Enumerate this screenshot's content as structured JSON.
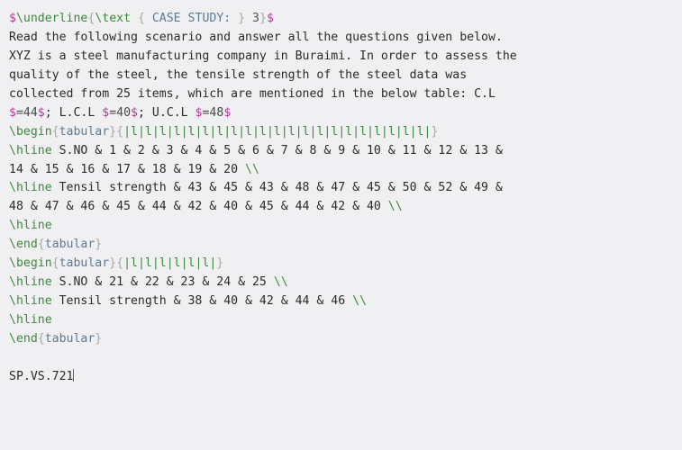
{
  "window": {
    "kind": "latex-source-editor",
    "background_color": "#f0f0f2",
    "font": "monospace",
    "colors": {
      "math_delimiter": "#b03a96",
      "command": "#3c8a3c",
      "brace": "#a8a8a8",
      "environment": "#5a7a96",
      "plain_text": "#2b2b2b",
      "cursor": "#3b6ea5"
    }
  },
  "document": {
    "lines": [
      {
        "id": "line-1",
        "tokens": [
          {
            "t": "$",
            "c": "math"
          },
          {
            "t": "\\underline",
            "c": "cmd"
          },
          {
            "t": "{",
            "c": "brace"
          },
          {
            "t": "\\text",
            "c": "cmd"
          },
          {
            "t": " ",
            "c": "plain"
          },
          {
            "t": "{",
            "c": "brace"
          },
          {
            "t": " CASE STUDY: ",
            "c": "env"
          },
          {
            "t": "}",
            "c": "brace"
          },
          {
            "t": " 3",
            "c": "arg"
          },
          {
            "t": "}",
            "c": "brace"
          },
          {
            "t": "$",
            "c": "math"
          }
        ]
      },
      {
        "id": "line-2",
        "tokens": [
          {
            "t": "Read the following scenario and answer all the questions given below.",
            "c": "plain"
          }
        ]
      },
      {
        "id": "line-3",
        "tokens": [
          {
            "t": "XYZ is a steel manufacturing company in Buraimi. In order to assess the",
            "c": "plain"
          }
        ]
      },
      {
        "id": "line-4",
        "tokens": [
          {
            "t": "quality of the steel, the tensile strength of the steel data was",
            "c": "plain"
          }
        ]
      },
      {
        "id": "line-5",
        "tokens": [
          {
            "t": "collected from 25 items, which are mentioned in the below table: C.L",
            "c": "plain"
          }
        ]
      },
      {
        "id": "line-6",
        "tokens": [
          {
            "t": "$",
            "c": "math"
          },
          {
            "t": "=44",
            "c": "mathbody"
          },
          {
            "t": "$",
            "c": "math"
          },
          {
            "t": "; L.C.L ",
            "c": "plain"
          },
          {
            "t": "$",
            "c": "math"
          },
          {
            "t": "=40",
            "c": "mathbody"
          },
          {
            "t": "$",
            "c": "math"
          },
          {
            "t": "; U.C.L ",
            "c": "plain"
          },
          {
            "t": "$",
            "c": "math"
          },
          {
            "t": "=48",
            "c": "mathbody"
          },
          {
            "t": "$",
            "c": "math"
          }
        ]
      },
      {
        "id": "line-7",
        "tokens": [
          {
            "t": "\\begin",
            "c": "cmd"
          },
          {
            "t": "{",
            "c": "brace"
          },
          {
            "t": "tabular",
            "c": "env"
          },
          {
            "t": "}",
            "c": "brace"
          },
          {
            "t": "{",
            "c": "brace"
          },
          {
            "t": "|l|l|l|l|l|l|l|l|l|l|l|l|l|l|l|l|l|l|l|l|l|",
            "c": "colspec"
          },
          {
            "t": "}",
            "c": "brace"
          }
        ]
      },
      {
        "id": "line-8",
        "tokens": [
          {
            "t": "\\hline",
            "c": "cmd"
          },
          {
            "t": " S.NO & 1 & 2 & 3 & 4 & 5 & 6 & 7 & 8 & 9 & 10 & 11 & 12 & 13 &",
            "c": "plain"
          }
        ]
      },
      {
        "id": "line-9",
        "tokens": [
          {
            "t": "14 & 15 & 16 & 17 & 18 & 19 & 20 ",
            "c": "plain"
          },
          {
            "t": "\\\\",
            "c": "cmd"
          }
        ]
      },
      {
        "id": "line-10",
        "tokens": [
          {
            "t": "\\hline",
            "c": "cmd"
          },
          {
            "t": " Tensil strength & 43 & 45 & 43 & 48 & 47 & 45 & 50 & 52 & 49 &",
            "c": "plain"
          }
        ]
      },
      {
        "id": "line-11",
        "tokens": [
          {
            "t": "48 & 47 & 46 & 45 & 44 & 42 & 40 & 45 & 44 & 42 & 40 ",
            "c": "plain"
          },
          {
            "t": "\\\\",
            "c": "cmd"
          }
        ]
      },
      {
        "id": "line-12",
        "tokens": [
          {
            "t": "\\hline",
            "c": "cmd"
          }
        ]
      },
      {
        "id": "line-13",
        "tokens": [
          {
            "t": "\\end",
            "c": "cmd"
          },
          {
            "t": "{",
            "c": "brace"
          },
          {
            "t": "tabular",
            "c": "env"
          },
          {
            "t": "}",
            "c": "brace"
          }
        ]
      },
      {
        "id": "line-14",
        "tokens": [
          {
            "t": "\\begin",
            "c": "cmd"
          },
          {
            "t": "{",
            "c": "brace"
          },
          {
            "t": "tabular",
            "c": "env"
          },
          {
            "t": "}",
            "c": "brace"
          },
          {
            "t": "{",
            "c": "brace"
          },
          {
            "t": "|l|l|l|l|l|l|",
            "c": "colspec"
          },
          {
            "t": "}",
            "c": "brace"
          }
        ]
      },
      {
        "id": "line-15",
        "tokens": [
          {
            "t": "\\hline",
            "c": "cmd"
          },
          {
            "t": " S.NO & 21 & 22 & 23 & 24 & 25 ",
            "c": "plain"
          },
          {
            "t": "\\\\",
            "c": "cmd"
          }
        ]
      },
      {
        "id": "line-16",
        "tokens": [
          {
            "t": "\\hline",
            "c": "cmd"
          },
          {
            "t": " Tensil strength & 38 & 40 & 42 & 44 & 46 ",
            "c": "plain"
          },
          {
            "t": "\\\\",
            "c": "cmd"
          }
        ]
      },
      {
        "id": "line-17",
        "tokens": [
          {
            "t": "\\hline",
            "c": "cmd"
          }
        ]
      },
      {
        "id": "line-18",
        "tokens": [
          {
            "t": "\\end",
            "c": "cmd"
          },
          {
            "t": "{",
            "c": "brace"
          },
          {
            "t": "tabular",
            "c": "env"
          },
          {
            "t": "}",
            "c": "brace"
          }
        ]
      },
      {
        "id": "line-19",
        "tokens": []
      },
      {
        "id": "line-20",
        "tokens": [
          {
            "t": "SP.VS.721",
            "c": "plain"
          }
        ],
        "cursor_after": true
      }
    ]
  },
  "table_data_1": {
    "headers": [
      "S.NO",
      "Tensil strength"
    ],
    "s_no": [
      1,
      2,
      3,
      4,
      5,
      6,
      7,
      8,
      9,
      10,
      11,
      12,
      13,
      14,
      15,
      16,
      17,
      18,
      19,
      20
    ],
    "tensil_strength": [
      43,
      45,
      43,
      48,
      47,
      45,
      50,
      52,
      49,
      48,
      47,
      46,
      45,
      44,
      42,
      40,
      45,
      44,
      42,
      40
    ]
  },
  "table_data_2": {
    "headers": [
      "S.NO",
      "Tensil strength"
    ],
    "s_no": [
      21,
      22,
      23,
      24,
      25
    ],
    "tensil_strength": [
      38,
      40,
      42,
      44,
      46
    ]
  },
  "control_limits": {
    "CL": 44,
    "LCL": 40,
    "UCL": 48
  },
  "footer_code": "SP.VS.721"
}
